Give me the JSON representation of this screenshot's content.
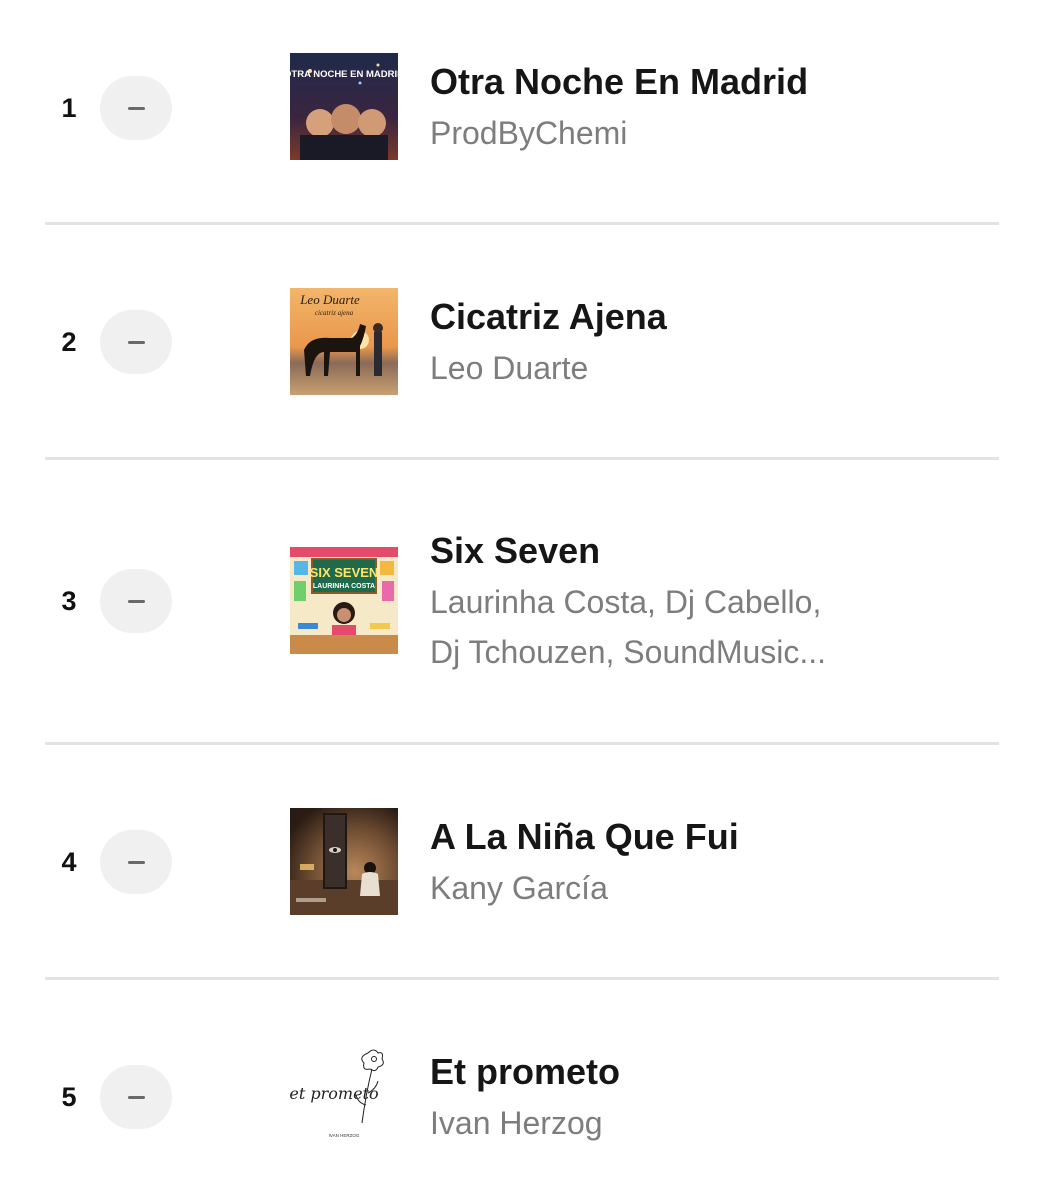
{
  "colors": {
    "title": "#161616",
    "artist": "#7d7d7d",
    "trend_pill": "#f0f0f0",
    "separator": "#e3e3e3"
  },
  "entries": [
    {
      "rank": "1",
      "trend_icon": "no-change-dash-icon",
      "cover_text": "OTRA NOCHE EN MADRID",
      "title": "Otra Noche En Madrid",
      "artist": "ProdByChemi"
    },
    {
      "rank": "2",
      "trend_icon": "no-change-dash-icon",
      "cover_text": "Leo Duarte",
      "cover_subtext": "cicatriz ajena",
      "title": "Cicatriz Ajena",
      "artist": "Leo Duarte"
    },
    {
      "rank": "3",
      "trend_icon": "no-change-dash-icon",
      "cover_text": "SIX SEVEN",
      "cover_subtext": "LAURINHA COSTA",
      "title": "Six Seven",
      "artist_line1": "Laurinha Costa, Dj Cabello,",
      "artist_line2": "Dj Tchouzen, SoundMusic..."
    },
    {
      "rank": "4",
      "trend_icon": "no-change-dash-icon",
      "title": "A La Niña Que Fui",
      "artist": "Kany García"
    },
    {
      "rank": "5",
      "trend_icon": "no-change-dash-icon",
      "cover_text": "et prometo",
      "cover_subtext": "IVAN HERZOG",
      "title": "Et prometo",
      "artist": "Ivan Herzog"
    }
  ]
}
